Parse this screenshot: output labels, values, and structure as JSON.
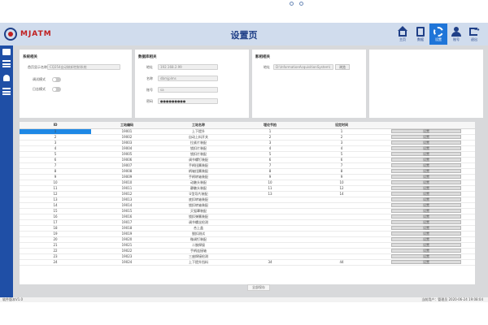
{
  "header": {
    "brand": "MJATM",
    "title": "设置页",
    "nav": [
      {
        "label": "主页",
        "icon": "home-icon"
      },
      {
        "label": "数据",
        "icon": "document-icon"
      },
      {
        "label": "设置",
        "icon": "gear-icon"
      },
      {
        "label": "账号",
        "icon": "users-icon"
      },
      {
        "label": "退出",
        "icon": "exit-icon"
      }
    ]
  },
  "sidebar": {
    "items": [
      "monitor",
      "menu",
      "alarm",
      "list"
    ]
  },
  "panels": {
    "system": {
      "title": "系统相关",
      "homepage_label": "首页显示名称",
      "homepage_value": "CQ254自动装卸控制系统",
      "debug_label": "调试模式",
      "log_label": "日志模式"
    },
    "database": {
      "title": "数据库相关",
      "address_label": "地址",
      "address_value": "192.168.2.99",
      "name_label": "名称",
      "name_value": "dbmjplms",
      "account_label": "账号",
      "account_value": "sa",
      "password_label": "密码",
      "password_value": "●●●●●●●●●"
    },
    "shadow": {
      "title": "影相相关",
      "address_label": "地址",
      "address_value": "D:\\InformationAcquisitionSystem\\",
      "browse_label": "浏览"
    }
  },
  "table": {
    "columns": [
      "ID",
      "工站编码",
      "工站名称",
      "埋论节拍",
      "设定时间",
      ""
    ],
    "rows": [
      [
        "1",
        "19001",
        "上下提升",
        "1",
        "1"
      ],
      [
        "2",
        "19002",
        "自动上料开关",
        "2",
        "2"
      ],
      [
        "3",
        "19003",
        "拉紧片装配",
        "3",
        "3"
      ],
      [
        "4",
        "19004",
        "锁扣片装配",
        "4",
        "4"
      ],
      [
        "5",
        "19005",
        "锁扣片装配",
        "5",
        "5"
      ],
      [
        "6",
        "19006",
        "调节螺钉装配",
        "6",
        "6"
      ],
      [
        "7",
        "19007",
        "手柄扭簧装配",
        "7",
        "7"
      ],
      [
        "8",
        "19008",
        "柄轴扭簧装配",
        "8",
        "8"
      ],
      [
        "9",
        "19009",
        "手柄转轴装配",
        "9",
        "9"
      ],
      [
        "10",
        "19010",
        "动触头装配",
        "10",
        "10"
      ],
      [
        "11",
        "19011",
        "静触头装配",
        "11",
        "12"
      ],
      [
        "12",
        "19012",
        "U型导片装配",
        "13",
        "14"
      ],
      [
        "13",
        "19013",
        "底扣转轴装配",
        "",
        ""
      ],
      [
        "14",
        "19014",
        "锁扣转轴装配",
        "",
        ""
      ],
      [
        "15",
        "19015",
        "灭弧罩装配",
        "",
        ""
      ],
      [
        "16",
        "19016",
        "锁扣弹簧装配",
        "",
        ""
      ],
      [
        "17",
        "19017",
        "调节螺丝检测",
        "",
        ""
      ],
      [
        "18",
        "19018",
        "合上盖",
        "",
        ""
      ],
      [
        "19",
        "19019",
        "脱扣测试",
        "",
        ""
      ],
      [
        "20",
        "19020",
        "微调钉装配",
        "",
        ""
      ],
      [
        "21",
        "19021",
        "二胺焊接",
        "",
        ""
      ],
      [
        "22",
        "19022",
        "手柄连接轴",
        "",
        ""
      ],
      [
        "23",
        "19023",
        "三座焊接检测",
        "",
        ""
      ],
      [
        "24",
        "19024",
        "上下提升挡料",
        "34",
        "44"
      ]
    ],
    "button_label": "设置",
    "save_all": "全部保存"
  },
  "status": {
    "left": "软件版本V1.0",
    "right": "当前用户：管理员   2020-06-24 19:08:04"
  }
}
